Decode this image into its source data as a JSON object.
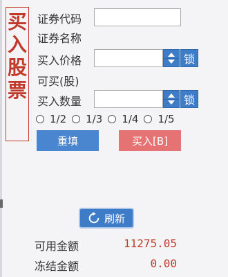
{
  "panel": {
    "title_chars": [
      "买",
      "入",
      "股",
      "票"
    ]
  },
  "form": {
    "code_label": "证券代码",
    "code_value": "",
    "name_label": "证券名称",
    "name_value": "",
    "price_label": "买入价格",
    "price_value": "",
    "price_lock": "锁",
    "available_label": "可买(股)",
    "available_value": "",
    "qty_label": "买入数量",
    "qty_value": "",
    "qty_lock": "锁",
    "fractions": [
      "1/2",
      "1/3",
      "1/4",
      "1/5"
    ]
  },
  "actions": {
    "reset": "重填",
    "buy": "买入[B]",
    "refresh": "刷新"
  },
  "funds": {
    "available_label": "可用金额",
    "available_value": "11275.05",
    "frozen_label": "冻结金额",
    "frozen_value": "0.00"
  },
  "colors": {
    "accent_blue": "#3f7cc7",
    "title_red": "#c0392b",
    "buy_red": "#e57373"
  }
}
